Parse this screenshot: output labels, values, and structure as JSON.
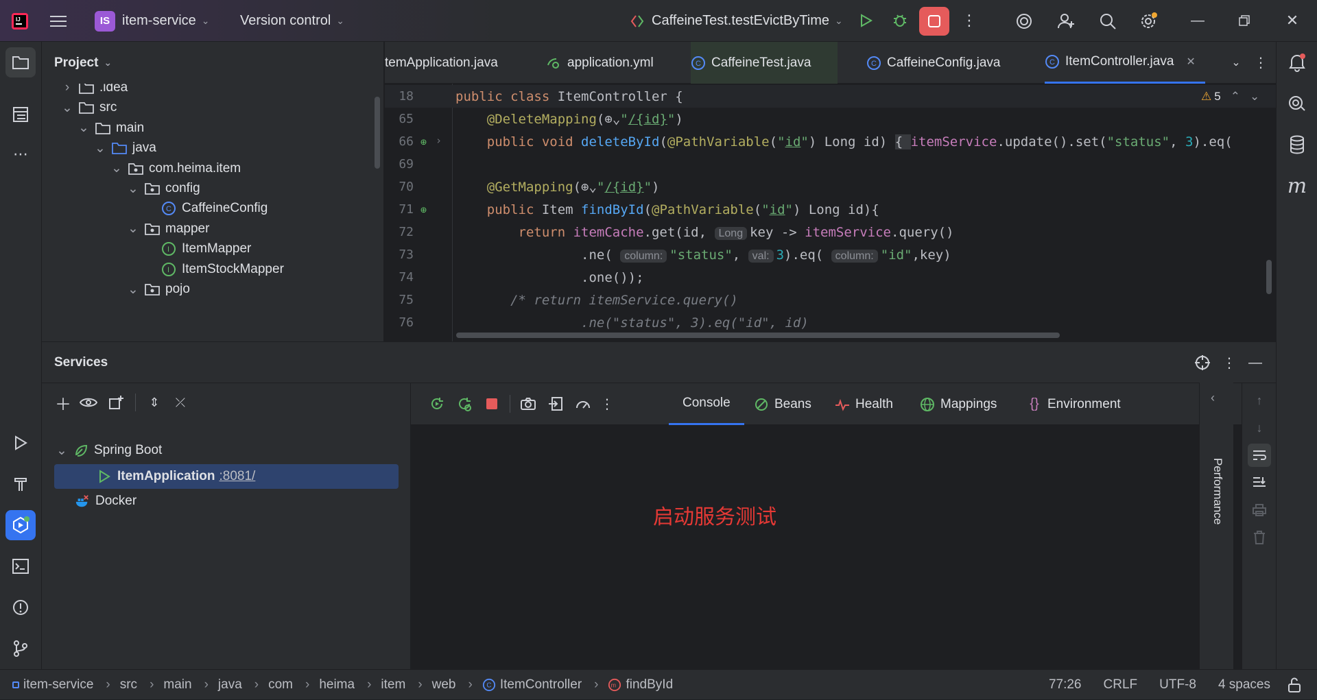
{
  "topbar": {
    "project_badge": "IS",
    "project_name": "item-service",
    "vcs_label": "Version control",
    "run_config": "CaffeineTest.testEvictByTime"
  },
  "project_panel": {
    "title": "Project",
    "tree": [
      {
        "label": ".idea",
        "depth": 1,
        "expanded": false,
        "icon": "folder-icon"
      },
      {
        "label": "src",
        "depth": 1,
        "expanded": true,
        "icon": "folder-icon"
      },
      {
        "label": "main",
        "depth": 2,
        "expanded": true,
        "icon": "folder-icon"
      },
      {
        "label": "java",
        "depth": 3,
        "expanded": true,
        "icon": "source-folder-icon"
      },
      {
        "label": "com.heima.item",
        "depth": 4,
        "expanded": true,
        "icon": "package-icon"
      },
      {
        "label": "config",
        "depth": 5,
        "expanded": true,
        "icon": "package-icon"
      },
      {
        "label": "CaffeineConfig",
        "depth": 6,
        "expanded": null,
        "icon": "class-icon"
      },
      {
        "label": "mapper",
        "depth": 5,
        "expanded": true,
        "icon": "package-icon"
      },
      {
        "label": "ItemMapper",
        "depth": 6,
        "expanded": null,
        "icon": "interface-icon"
      },
      {
        "label": "ItemStockMapper",
        "depth": 6,
        "expanded": null,
        "icon": "interface-icon"
      },
      {
        "label": "pojo",
        "depth": 5,
        "expanded": true,
        "icon": "package-icon"
      }
    ]
  },
  "editor": {
    "tabs": [
      {
        "label": "temApplication.java",
        "icon": "",
        "active": false
      },
      {
        "label": "application.yml",
        "icon": "yaml-icon",
        "active": false
      },
      {
        "label": "CaffeineTest.java",
        "icon": "class-icon",
        "active": false
      },
      {
        "label": "CaffeineConfig.java",
        "icon": "class-icon",
        "active": false
      },
      {
        "label": "ItemController.java",
        "icon": "class-icon",
        "active": true
      }
    ],
    "warning_count": "5",
    "sticky": {
      "num": "18",
      "text": "public class ItemController {"
    },
    "lines": [
      {
        "num": "65",
        "text": "    @DeleteMapping(⊕\"/{id}\")"
      },
      {
        "num": "66",
        "text": "    public void deleteById(@PathVariable(\"id\") Long id) { itemService.update().set(\"status\", 3).eq("
      },
      {
        "num": "69",
        "text": ""
      },
      {
        "num": "70",
        "text": "    @GetMapping(⊕\"/{id}\")"
      },
      {
        "num": "71",
        "text": "    public Item findById(@PathVariable(\"id\") Long id){"
      },
      {
        "num": "72",
        "text": "        return itemCache.get(id, Long key -> itemService.query()"
      },
      {
        "num": "73",
        "text": "                .ne( column: \"status\", val: 3).eq( column: \"id\",key)"
      },
      {
        "num": "74",
        "text": "                .one());"
      },
      {
        "num": "75",
        "text": "       /* return itemService.query()"
      },
      {
        "num": "76",
        "text": "                .ne(\"status\", 3).eq(\"id\", id)"
      }
    ]
  },
  "services": {
    "title": "Services",
    "tree": [
      {
        "label": "Spring Boot"
      },
      {
        "label": "ItemApplication",
        "port": ":8081/"
      },
      {
        "label": "Docker"
      }
    ],
    "console_tabs": [
      "Console",
      "Beans",
      "Health",
      "Mappings",
      "Environment"
    ],
    "console_text": "启动服务测试",
    "side_label": "Performance"
  },
  "statusbar": {
    "breadcrumbs": [
      "item-service",
      "src",
      "main",
      "java",
      "com",
      "heima",
      "item",
      "web",
      "ItemController",
      "findById"
    ],
    "position": "77:26",
    "line_sep": "CRLF",
    "encoding": "UTF-8",
    "indent": "4 spaces"
  },
  "colors": {
    "accent": "#3574f0",
    "stop": "#e55b5b",
    "run": "#5fb865",
    "console_text": "#e53935"
  }
}
